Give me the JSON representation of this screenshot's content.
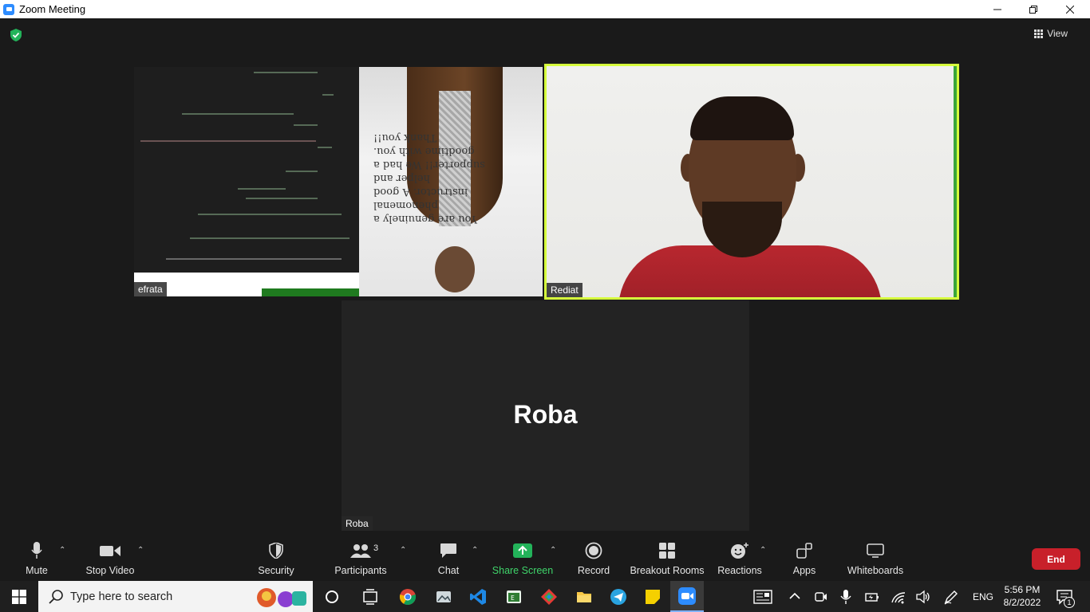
{
  "window": {
    "title": "Zoom Meeting"
  },
  "top_bar": {
    "view_label": "View"
  },
  "tiles": [
    {
      "name": "efrata"
    },
    {
      "name": "Rediat"
    },
    {
      "name": "Roba",
      "display_name": "Roba"
    }
  ],
  "shared_note": {
    "text": "You are genuinely a phenomenal instructor. A good helper and supporter!! We had a goodtime with you. Thank you!!"
  },
  "toolbar": {
    "mute_label": "Mute",
    "stop_video_label": "Stop Video",
    "security_label": "Security",
    "participants_label": "Participants",
    "participants_count": "3",
    "chat_label": "Chat",
    "share_screen_label": "Share Screen",
    "record_label": "Record",
    "breakout_label": "Breakout Rooms",
    "reactions_label": "Reactions",
    "apps_label": "Apps",
    "whiteboards_label": "Whiteboards",
    "end_label": "End"
  },
  "taskbar": {
    "search_placeholder": "Type here to search",
    "language": "ENG",
    "time": "5:56 PM",
    "date": "8/2/2022",
    "notification_count": "1"
  },
  "colors": {
    "active_speaker_border": "#d6ff3c",
    "share_green": "#3fd46a",
    "end_red": "#c8202a",
    "zoom_blue": "#2d8cff"
  }
}
